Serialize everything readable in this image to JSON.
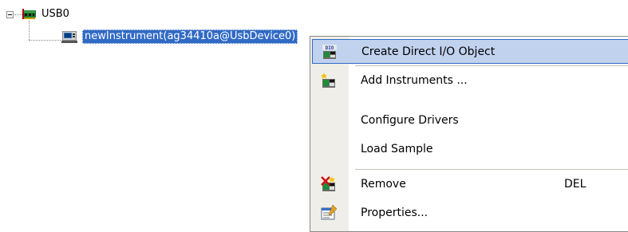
{
  "tree": {
    "root": {
      "label": "USB0",
      "icon": "usb-card-icon",
      "expander": "collapse-minus-icon"
    },
    "child": {
      "label": "newInstrument(ag34410a@UsbDevice0)",
      "icon": "instrument-icon",
      "selected": true
    }
  },
  "context_menu": {
    "items": [
      {
        "label": "Create Direct I/O Object",
        "icon": "direct-io-icon",
        "highlighted": true,
        "shortcut": ""
      },
      {
        "label": "Add Instruments ...",
        "icon": "add-instrument-icon",
        "shortcut": ""
      },
      {
        "label": "Configure Drivers",
        "icon": "",
        "shortcut": ""
      },
      {
        "label": "Load Sample",
        "icon": "",
        "shortcut": ""
      },
      {
        "label": "Remove",
        "icon": "remove-instrument-icon",
        "shortcut": "DEL"
      },
      {
        "label": "Properties...",
        "icon": "properties-icon",
        "shortcut": ""
      }
    ]
  },
  "colors": {
    "selection": "#316ac5",
    "menu_highlight": "#c1d2ee",
    "menu_gutter": "#f0eee8"
  }
}
